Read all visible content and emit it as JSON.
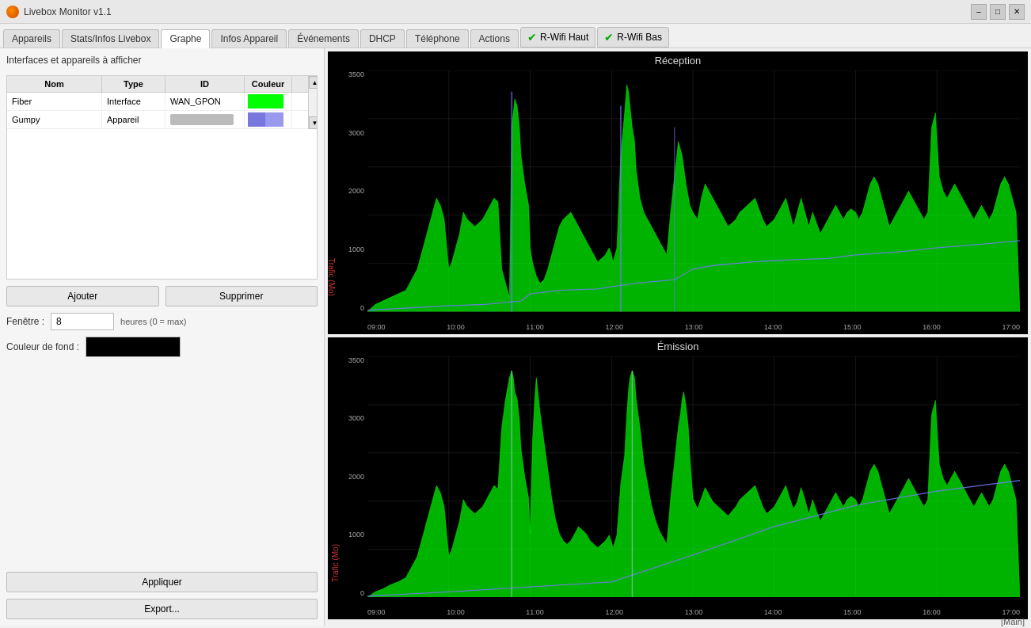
{
  "titleBar": {
    "title": "Livebox Monitor v1.1",
    "controls": [
      "minimize",
      "maximize",
      "close"
    ]
  },
  "tabs": [
    {
      "id": "appareils",
      "label": "Appareils",
      "active": false
    },
    {
      "id": "stats",
      "label": "Stats/Infos Livebox",
      "active": false
    },
    {
      "id": "graphe",
      "label": "Graphe",
      "active": true
    },
    {
      "id": "infos",
      "label": "Infos Appareil",
      "active": false
    },
    {
      "id": "evenements",
      "label": "Événements",
      "active": false
    },
    {
      "id": "dhcp",
      "label": "DHCP",
      "active": false
    },
    {
      "id": "telephone",
      "label": "Téléphone",
      "active": false
    },
    {
      "id": "actions",
      "label": "Actions",
      "active": false
    },
    {
      "id": "rwifi-haut",
      "label": "R-Wifi Haut",
      "active": false,
      "checked": true
    },
    {
      "id": "rwifi-bas",
      "label": "R-Wifi Bas",
      "active": false,
      "checked": true
    }
  ],
  "leftPanel": {
    "sectionTitle": "Interfaces et appareils à afficher",
    "tableHeaders": [
      "Nom",
      "Type",
      "ID",
      "Couleur"
    ],
    "tableRows": [
      {
        "nom": "Fiber",
        "type": "Interface",
        "id": "WAN_GPON",
        "color": "#00ff00"
      },
      {
        "nom": "Gumpy",
        "type": "Appareil",
        "id": "blurred",
        "color": "#6666cc"
      }
    ],
    "addButton": "Ajouter",
    "removeButton": "Supprimer",
    "windowLabel": "Fenêtre :",
    "windowValue": "8",
    "windowHint": "heures (0 = max)",
    "bgColorLabel": "Couleur de fond :",
    "bgColor": "#000000",
    "applyButton": "Appliquer",
    "exportButton": "Export..."
  },
  "charts": {
    "reception": {
      "title": "Réception",
      "yAxisLabel": "Trafic (Mo)",
      "yLabels": [
        "3500",
        "3000",
        "2000",
        "1000",
        "0"
      ],
      "xLabels": [
        "09:00",
        "10:00",
        "11:00",
        "12:00",
        "13:00",
        "14:00",
        "15:00",
        "16:00",
        "17:00"
      ]
    },
    "emission": {
      "title": "Émission",
      "yAxisLabel": "Trafic (Mo)",
      "yLabels": [
        "3500",
        "3000",
        "2000",
        "1000",
        "0"
      ],
      "xLabels": [
        "09:00",
        "10:00",
        "11:00",
        "12:00",
        "13:00",
        "14:00",
        "15:00",
        "16:00",
        "17:00"
      ]
    }
  },
  "statusBar": {
    "text": "[Main]"
  }
}
